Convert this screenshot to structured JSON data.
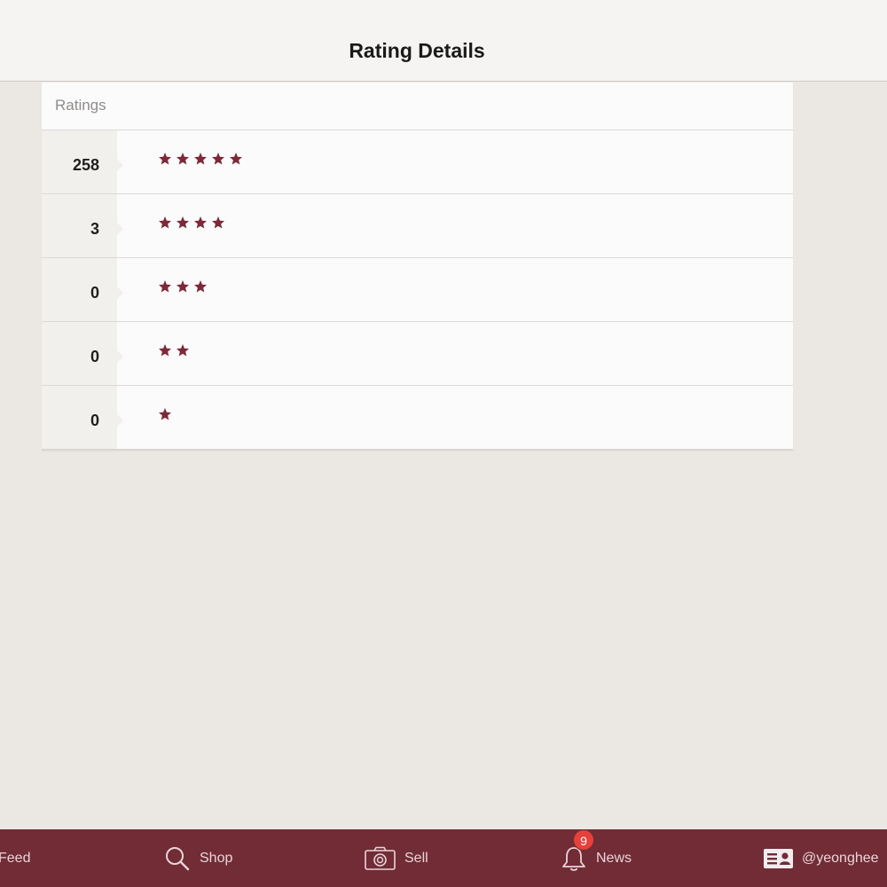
{
  "header": {
    "title": "Rating Details"
  },
  "card": {
    "header_label": "Ratings",
    "rows": [
      {
        "count": "258",
        "stars": 5
      },
      {
        "count": "3",
        "stars": 4
      },
      {
        "count": "0",
        "stars": 3
      },
      {
        "count": "0",
        "stars": 2
      },
      {
        "count": "0",
        "stars": 1
      }
    ]
  },
  "tabs": [
    {
      "label": "Feed"
    },
    {
      "label": "Shop",
      "icon": "search-icon"
    },
    {
      "label": "Sell",
      "icon": "camera-icon"
    },
    {
      "label": "News",
      "icon": "bell-icon",
      "badge": "9"
    },
    {
      "label": "@yeonghee",
      "icon": "profile-card-icon"
    }
  ],
  "colors": {
    "accent": "#712c36",
    "star": "#7c2a38",
    "badge": "#e5403a"
  }
}
